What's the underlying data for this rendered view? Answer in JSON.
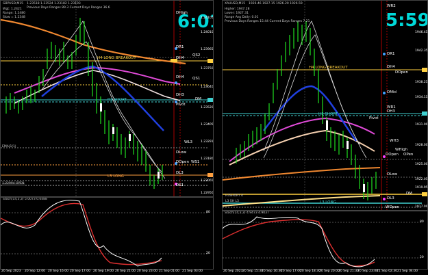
{
  "left": {
    "symbol_line": "GBPUSD,M15",
    "info_lines": [
      "Wgt: 1.2421",
      "Range: 1.2480",
      "Slow = 1.2348"
    ],
    "header_text": "1.23518 1.23524 1.23182 1.23193",
    "ranges_text": "Previous Days Ranges 89.3   Current Days Ranges 36.6",
    "timer": "6:01",
    "labels": {
      "dmah": "DHigh",
      "dr1": "DR1",
      "dh4": "DH4",
      "qs2": "QS2",
      "h4_long_breakout": "H4 LONG BREAKOUT",
      "dh4_2": "DH4",
      "qs1": "QS1",
      "dh3": "DH3",
      "dm": "DM",
      "h3_short": "H3 SHORT",
      "pivot": "Pivot",
      "wl3": "WL3",
      "dlow": "DLow",
      "dopen": "DOpen",
      "ws1": "WS1",
      "dl3": "DL3",
      "l3_long": "L3 LONG",
      "ds1": "DS1",
      "ema_tag": "EMA(1/1)",
      "open_tag": "1.22994  OPEN"
    },
    "price_ticks": [
      "1.24105",
      "1.24010",
      "1.23965",
      "1.23750",
      "1.23640",
      "1.23520",
      "1.23405",
      "1.23291",
      "1.23180",
      "1.23065",
      "1.22950"
    ],
    "osc_title": "Stoch(14,3,3)  5.0073  0.0488",
    "osc_ticks": [
      "80",
      "20"
    ],
    "time_axis": [
      "20 Sep 2023",
      "20 Sep 12:00",
      "20 Sep 16:00",
      "20 Sep 17:00",
      "20 Sep 19:00",
      "20 Sep 21:00",
      "20 Sep 23:00",
      "21 Sep 01:00",
      "21 Sep 03:00"
    ]
  },
  "right": {
    "symbol_line": "XAUUSD,M15",
    "info_lines": [
      "Higher: 1947.28",
      "Lower: 1927.31",
      "Range Avg Daily: 0.01"
    ],
    "header_text": "1926.46 1927.15 1926.20 1926.59",
    "ranges_text": "Previous Days Ranges 15.44   Current Days Ranges 7.21",
    "timer": "5:59",
    "labels": {
      "wr2": "WR2",
      "dr1": "DR1",
      "dh4": "DH4",
      "dopen_top": "DOpen",
      "h4_long_breakout": "H4 LONG BREAKOUT",
      "dmid": "DMid",
      "wr1": "WR1",
      "dh3": "DH3",
      "h3_short": "H3 SHORT",
      "pivot": "Pivot",
      "wh3": "WH3",
      "whigh": "WHigh",
      "dopen": "DOpen",
      "open2": "OPen",
      "dlow": "DLow",
      "dm": "DM",
      "dl3": "DL3",
      "l3_long": "L3 LONG",
      "wopen": "WOpen",
      "h3sh_tag": "H3SHORT 4",
      "l3sh_tag": "L3 SH L3"
    },
    "price_ticks": [
      "1946.45",
      "1942.35",
      "1938.25",
      "1934.15",
      "1931.00",
      "1928.00",
      "1925.00",
      "1922.05",
      "1919.95",
      "1917.00"
    ],
    "osc_title": "Stoch(14,3,3)  4.9473  4.9037",
    "osc_ticks": [
      "80",
      "20"
    ],
    "time_axis": [
      "20 Sep 2023",
      "20 Sep 15:30",
      "20 Sep 16:30",
      "20 Sep 17:00",
      "20 Sep 18:30",
      "20 Sep 20:00",
      "20 Sep 21:30",
      "20 Sep 23:00",
      "21 Sep 02:30",
      "21 Sep 04:00"
    ]
  }
}
